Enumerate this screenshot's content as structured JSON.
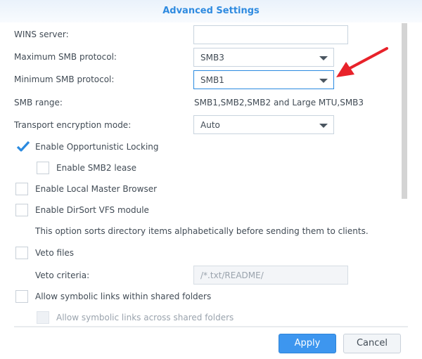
{
  "dialog": {
    "title": "Advanced Settings"
  },
  "fields": {
    "wins_server": {
      "label": "WINS server:",
      "value": ""
    },
    "max_smb": {
      "label": "Maximum SMB protocol:",
      "value": "SMB3"
    },
    "min_smb": {
      "label": "Minimum SMB protocol:",
      "value": "SMB1"
    },
    "smb_range": {
      "label": "SMB range:",
      "value": "SMB1,SMB2,SMB2 and Large MTU,SMB3"
    },
    "transport_encryption": {
      "label": "Transport encryption mode:",
      "value": "Auto"
    }
  },
  "checkboxes": {
    "opportunistic_locking": {
      "label": "Enable Opportunistic Locking",
      "checked": true
    },
    "smb2_lease": {
      "label": "Enable SMB2 lease",
      "checked": false
    },
    "local_master_browser": {
      "label": "Enable Local Master Browser",
      "checked": false
    },
    "dirsort": {
      "label": "Enable DirSort VFS module",
      "checked": false,
      "description": "This option sorts directory items alphabetically before sending them to clients."
    },
    "veto_files": {
      "label": "Veto files",
      "checked": false
    },
    "symlinks_within": {
      "label": "Allow symbolic links within shared folders",
      "checked": false
    },
    "symlinks_across": {
      "label": "Allow symbolic links across shared folders",
      "checked": false,
      "disabled": true
    }
  },
  "veto_criteria": {
    "label": "Veto criteria:",
    "placeholder": "/*.txt/README/"
  },
  "buttons": {
    "apply": "Apply",
    "cancel": "Cancel"
  },
  "annotation": {
    "color": "#e8222a"
  }
}
